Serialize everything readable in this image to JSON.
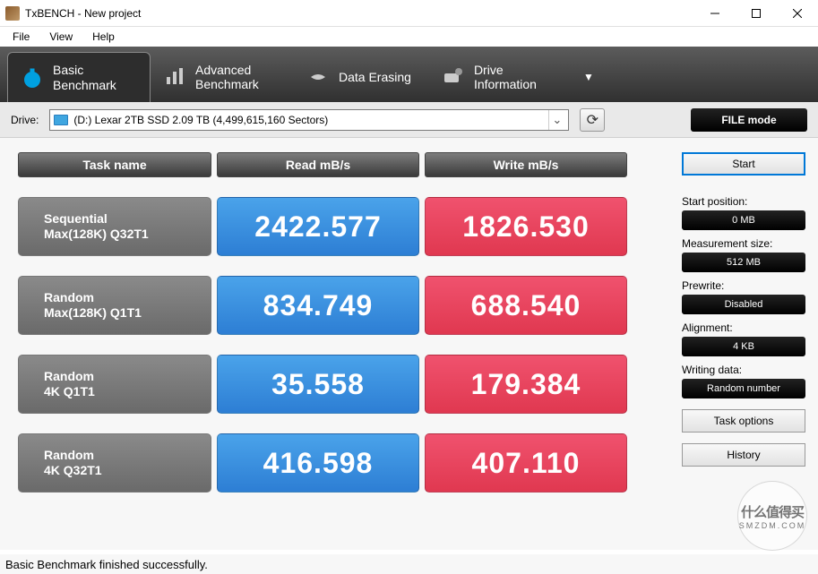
{
  "window": {
    "title": "TxBENCH - New project"
  },
  "menu": {
    "file": "File",
    "view": "View",
    "help": "Help"
  },
  "tabs": {
    "basic": {
      "line1": "Basic",
      "line2": "Benchmark"
    },
    "advanced": {
      "line1": "Advanced",
      "line2": "Benchmark"
    },
    "erasing": {
      "line1": "Data Erasing"
    },
    "driveinfo": {
      "line1": "Drive",
      "line2": "Information"
    }
  },
  "drive": {
    "label": "Drive:",
    "value": "(D:) Lexar 2TB SSD  2.09 TB (4,499,615,160 Sectors)"
  },
  "filemode_btn": "FILE mode",
  "headers": {
    "task": "Task name",
    "read": "Read mB/s",
    "write": "Write mB/s"
  },
  "chart_data": {
    "type": "table",
    "title": "Basic Benchmark",
    "columns": [
      "Task name",
      "Read mB/s",
      "Write mB/s"
    ],
    "rows": [
      {
        "name_l1": "Sequential",
        "name_l2": "Max(128K) Q32T1",
        "read": "2422.577",
        "write": "1826.530"
      },
      {
        "name_l1": "Random",
        "name_l2": "Max(128K) Q1T1",
        "read": "834.749",
        "write": "688.540"
      },
      {
        "name_l1": "Random",
        "name_l2": "4K Q1T1",
        "read": "35.558",
        "write": "179.384"
      },
      {
        "name_l1": "Random",
        "name_l2": "4K Q32T1",
        "read": "416.598",
        "write": "407.110"
      }
    ]
  },
  "side": {
    "start": "Start",
    "start_pos": {
      "k": "Start position:",
      "v": "0 MB"
    },
    "measure_size": {
      "k": "Measurement size:",
      "v": "512 MB"
    },
    "prewrite": {
      "k": "Prewrite:",
      "v": "Disabled"
    },
    "alignment": {
      "k": "Alignment:",
      "v": "4 KB"
    },
    "writing_data": {
      "k": "Writing data:",
      "v": "Random number"
    },
    "task_options": "Task options",
    "history": "History"
  },
  "status": "Basic Benchmark finished successfully.",
  "watermark": {
    "big": "什么值得买",
    "small": "SMZDM.COM"
  }
}
